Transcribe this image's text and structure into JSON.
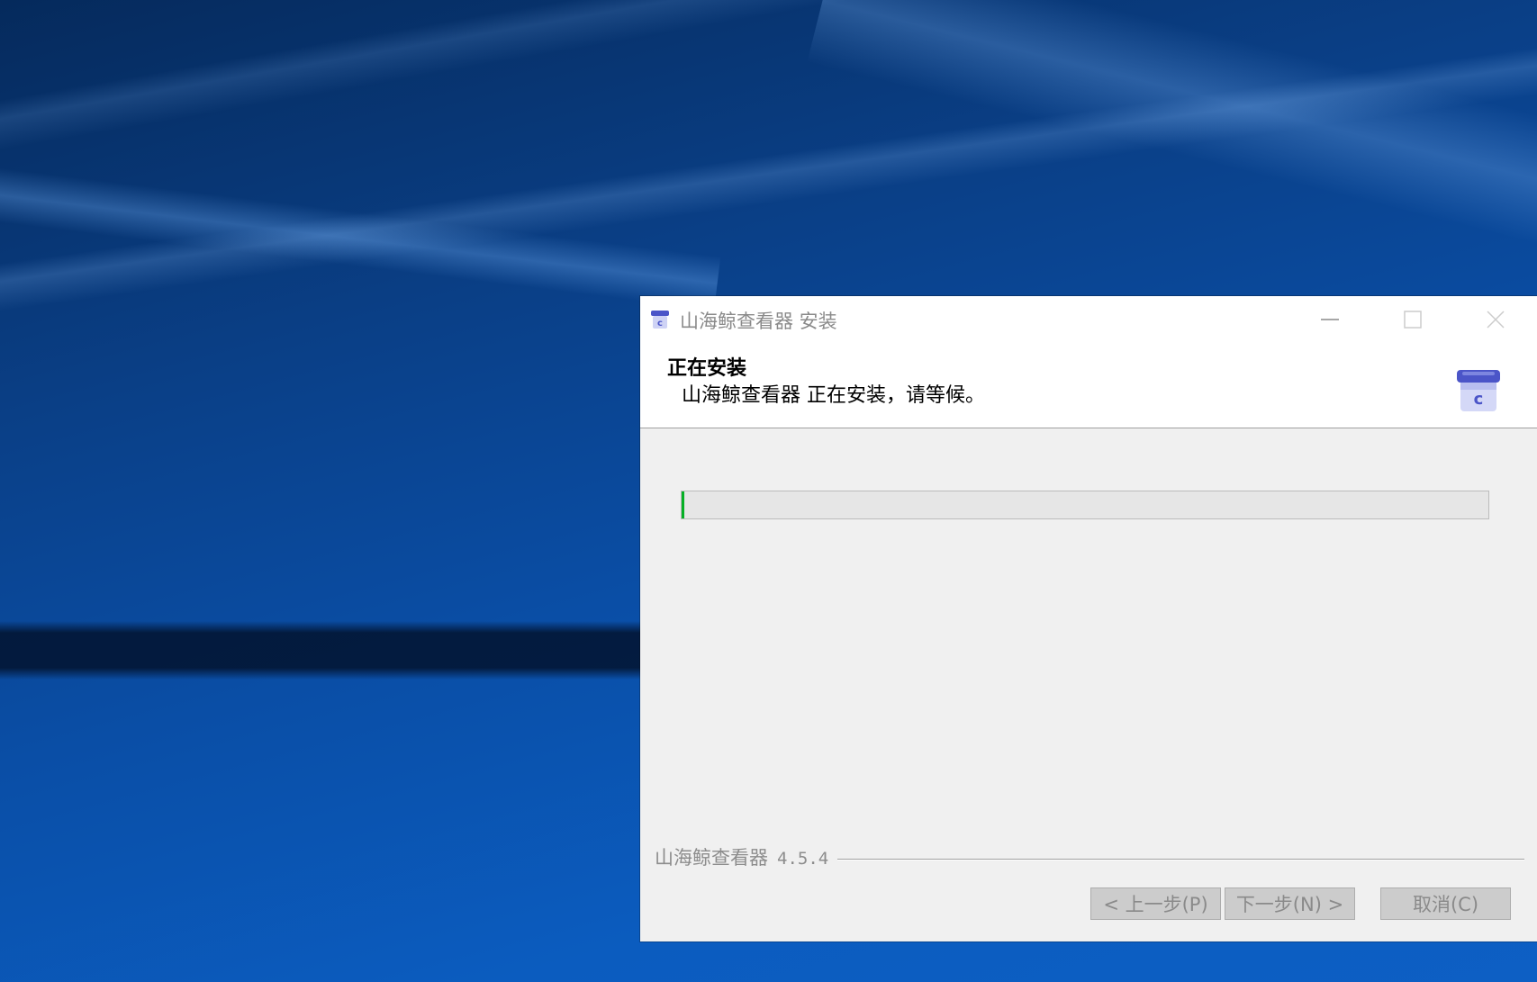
{
  "window": {
    "title": "山海鲸查看器 安装"
  },
  "header": {
    "title": "正在安装",
    "subtitle": "山海鲸查看器 正在安装，请等候。"
  },
  "progress": {
    "value_percent": 0.3
  },
  "footer": {
    "brand": "山海鲸查看器",
    "version": "4.5.4"
  },
  "buttons": {
    "back": "< 上一步(P)",
    "next": "下一步(N) >",
    "cancel": "取消(C)"
  },
  "colors": {
    "progress_fill": "#06b025",
    "icon_blue": "#4b55c8"
  },
  "icons": {
    "app": "installer-box-icon",
    "minimize": "minimize-icon",
    "maximize": "maximize-icon",
    "close": "close-icon"
  }
}
